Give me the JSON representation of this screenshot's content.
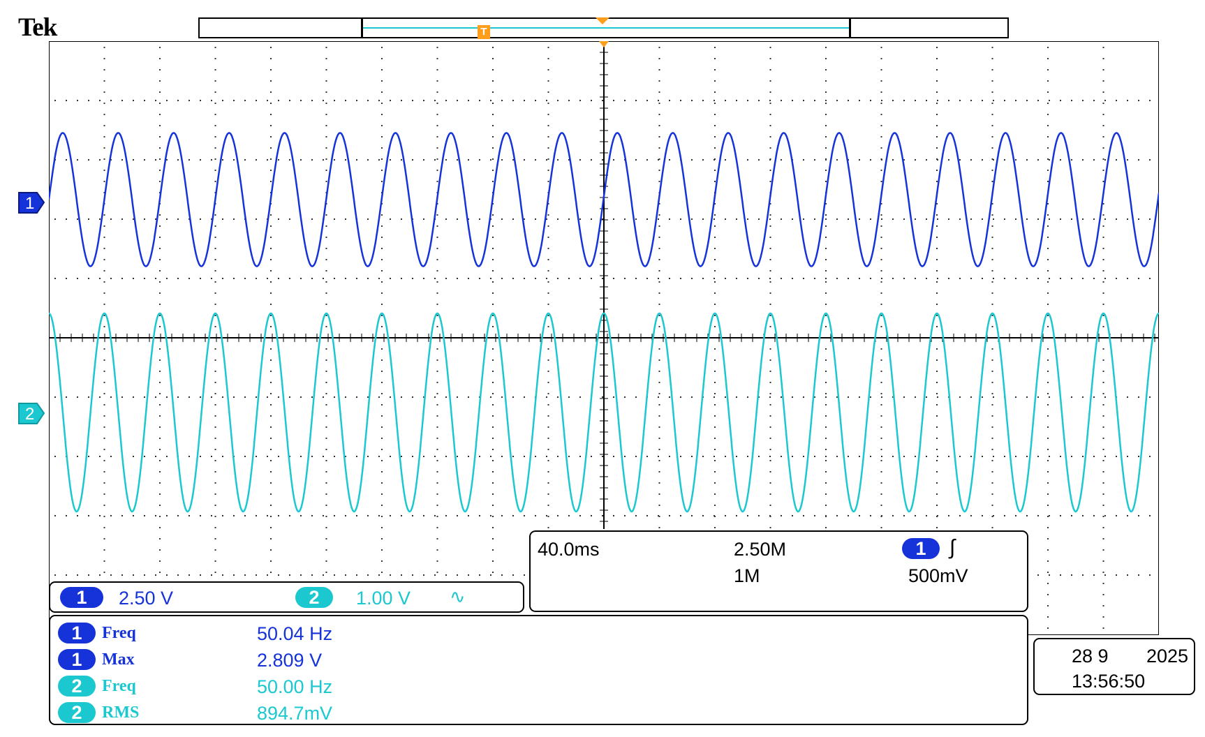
{
  "brand": "Tek",
  "colors": {
    "ch1": "#1533d8",
    "ch2": "#1cc8d0",
    "trigger": "#ff9e1b"
  },
  "trigger_marker": "T",
  "channels": [
    {
      "id": "1",
      "marker_label": "1",
      "scale": "2.50 V",
      "color": "#1533d8"
    },
    {
      "id": "2",
      "marker_label": "2",
      "scale": "1.00 V",
      "coupling_icon": "ac-coupling-icon",
      "coupling_symbol": "∿",
      "color": "#1cc8d0"
    }
  ],
  "timebase": {
    "horizontal_scale": "40.0ms",
    "sample_rate": "2.50M",
    "record_length": "1M",
    "trigger_source": "1",
    "trigger_slope_icon": "rising-edge-icon",
    "trigger_slope_symbol": "∫",
    "trigger_level": "500mV"
  },
  "measurements": [
    {
      "channel": "1",
      "name": "Freq",
      "value": "50.04 Hz"
    },
    {
      "channel": "1",
      "name": "Max",
      "value": "2.809 V"
    },
    {
      "channel": "2",
      "name": "Freq",
      "value": "50.00 Hz"
    },
    {
      "channel": "2",
      "name": "RMS",
      "value": "894.7mV"
    }
  ],
  "datetime": {
    "date": "28 9",
    "year": "2025",
    "time": "13:56:50"
  },
  "chart_data": {
    "type": "line",
    "title": "",
    "xlabel": "",
    "ylabel": "",
    "grid": true,
    "x_divisions": 10,
    "y_divisions": 8,
    "time_per_div_ms": 40,
    "series": [
      {
        "name": "1",
        "waveform": "sine",
        "frequency_hz": 50.04,
        "max_v": 2.809,
        "volts_per_div": 2.5,
        "color": "#1533d8"
      },
      {
        "name": "2",
        "waveform": "sine",
        "frequency_hz": 50.0,
        "rms_v": 0.8947,
        "volts_per_div": 1.0,
        "color": "#1cc8d0"
      }
    ]
  }
}
